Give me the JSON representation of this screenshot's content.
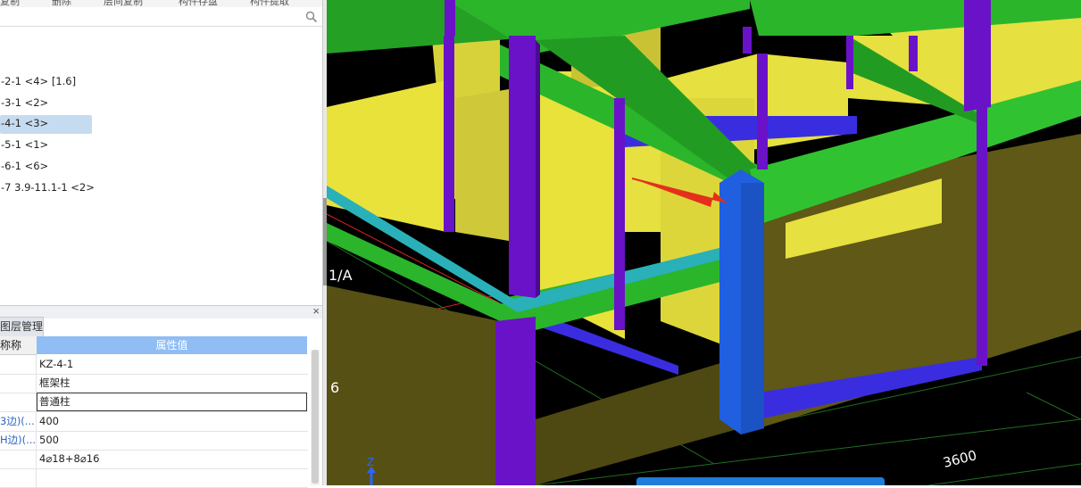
{
  "toolbar": {
    "items": [
      "复制",
      "删除",
      "层间复制",
      "构件存盘",
      "构件提取"
    ]
  },
  "tree": {
    "items": [
      {
        "label": "-2-1 <4> [1.6]",
        "selected": false
      },
      {
        "label": "-3-1 <2>",
        "selected": false
      },
      {
        "label": "-4-1 <3>",
        "selected": true
      },
      {
        "label": "-5-1 <1>",
        "selected": false
      },
      {
        "label": "-6-1 <6>",
        "selected": false
      },
      {
        "label": "-7 3.9-11.1-1 <2>",
        "selected": false
      }
    ]
  },
  "properties": {
    "tab_label": "图层管理",
    "close_label": "×",
    "col_name": "称称",
    "col_value": "属性值",
    "rows": [
      {
        "name": "",
        "value": "KZ-4-1"
      },
      {
        "name": "",
        "value": "框架柱"
      },
      {
        "name": "",
        "value": "普通柱",
        "editing": true
      },
      {
        "name": "3边)(...",
        "value": "400"
      },
      {
        "name": "H边)(...",
        "value": "500"
      },
      {
        "name": "",
        "value": "4⌀18+8⌀16"
      },
      {
        "name": "",
        "value": ""
      }
    ]
  },
  "viewport": {
    "axis_label_a": "1/A",
    "axis_label_b": "6",
    "dimension_label": "3600",
    "z_axis_label": "Z",
    "colors": {
      "beam_green": "#2bb52b",
      "wall_yellow": "#e8e23a",
      "wall_olive": "#6b6219",
      "column_purple": "#6a12c8",
      "column_blue": "#1f5fe0",
      "beam_cyan": "#2ab0b8",
      "arrow_red": "#e3301c"
    }
  }
}
